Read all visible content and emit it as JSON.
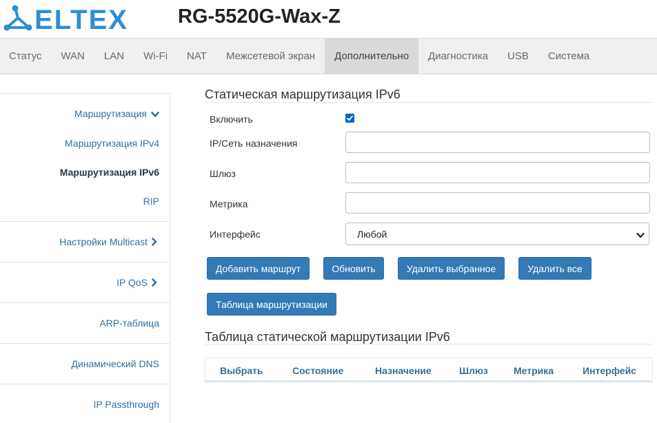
{
  "header": {
    "logo_text": "ELTEX",
    "device_title": "RG-5520G-Wax-Z"
  },
  "topnav": {
    "tabs": [
      {
        "label": "Статус"
      },
      {
        "label": "WAN"
      },
      {
        "label": "LAN"
      },
      {
        "label": "Wi-Fi"
      },
      {
        "label": "NAT"
      },
      {
        "label": "Межсетевой экран"
      },
      {
        "label": "Дополнительно",
        "active": true
      },
      {
        "label": "Диагностика"
      },
      {
        "label": "USB"
      },
      {
        "label": "Система"
      }
    ]
  },
  "sidebar": {
    "items": [
      {
        "label": "Маршрутизация",
        "icon": "chevron-down-icon"
      },
      {
        "label": "Маршрутизация IPv4"
      },
      {
        "label": "Маршрутизация IPv6",
        "active": true
      },
      {
        "label": "RIP"
      },
      {
        "label": "Настройки Multicast",
        "icon": "chevron-right-icon"
      },
      {
        "label": "IP QoS",
        "icon": "chevron-right-icon"
      },
      {
        "label": "ARP-таблица"
      },
      {
        "label": "Динамический DNS"
      },
      {
        "label": "IP Passthrough"
      }
    ]
  },
  "form": {
    "title": "Статическая маршрутизация IPv6",
    "enable_label": "Включить",
    "enable_checked": true,
    "destination_label": "IP/Сеть назначения",
    "destination_value": "",
    "gateway_label": "Шлюз",
    "gateway_value": "",
    "metric_label": "Метрика",
    "metric_value": "",
    "interface_label": "Интерфейс",
    "interface_value": "Любой"
  },
  "buttons": {
    "add_route": "Добавить маршрут",
    "refresh": "Обновить",
    "delete_selected": "Удалить выбранное",
    "delete_all": "Удалить все",
    "routing_table": "Таблица маршрутизации"
  },
  "table": {
    "title": "Таблица статической маршрутизации IPv6",
    "columns": [
      "Выбрать",
      "Состояние",
      "Назначение",
      "Шлюз",
      "Метрика",
      "Интерфейс"
    ],
    "rows": []
  },
  "colors": {
    "accent": "#337ab7",
    "link": "#2f6fa7",
    "nav_bg": "#f0f0f0",
    "nav_active_bg": "#d9d9d9",
    "logo": "#2b8fd6"
  }
}
